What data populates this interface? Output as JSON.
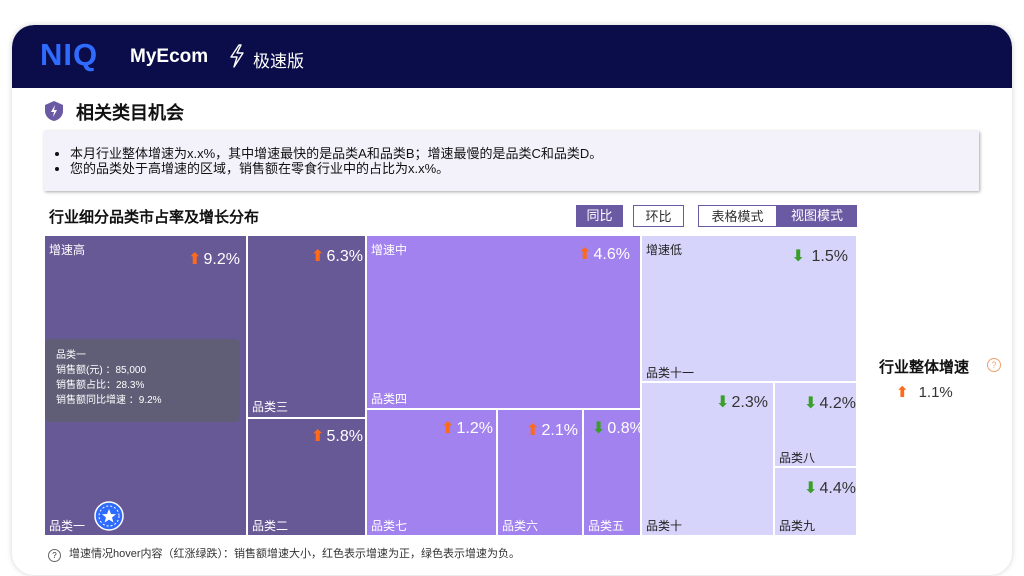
{
  "header": {
    "logo": "NIQ",
    "app_name": "MyEcom",
    "edition": "极速版"
  },
  "section": {
    "title": "相关类目机会"
  },
  "insights": [
    "本月行业整体增速为x.x%，其中增速最快的是品类A和品类B；增速最慢的是品类C和品类D。",
    "您的品类处于高增速的区域，销售额在零食行业中的占比为x.x%。"
  ],
  "chart": {
    "title": "行业细分品类市占率及增长分布"
  },
  "toggles": {
    "yoy": "同比",
    "mom": "环比",
    "table_mode": "表格模式",
    "view_mode": "视图模式"
  },
  "groups": {
    "high": "增速高",
    "mid": "增速中",
    "low": "增速低"
  },
  "tiles": {
    "cat1": {
      "name": "品类一",
      "growth": "9.2%"
    },
    "cat3": {
      "name": "品类三",
      "growth": "6.3%"
    },
    "cat2": {
      "name": "品类二",
      "growth": "5.8%"
    },
    "cat4": {
      "name": "品类四",
      "growth": "4.6%"
    },
    "cat7": {
      "name": "品类七",
      "growth": "1.2%"
    },
    "cat6": {
      "name": "品类六",
      "growth": "2.1%"
    },
    "cat5": {
      "name": "品类五",
      "growth": "0.8%"
    },
    "cat11": {
      "name": "品类十一",
      "growth": "1.5%"
    },
    "cat10": {
      "name": "品类十",
      "growth": "2.3%"
    },
    "cat8": {
      "name": "品类八",
      "growth": "4.2%"
    },
    "cat9": {
      "name": "品类九",
      "growth": "4.4%"
    }
  },
  "tooltip": {
    "name": "品类一",
    "sales": "销售额(元) ：85,000",
    "share": "销售额占比：28.3%",
    "yoy": "销售额同比增速 ：9.2%"
  },
  "overall": {
    "title": "行业整体增速",
    "value": "1.1%",
    "help": "?"
  },
  "footer": {
    "note": "增速情况hover内容（红涨绿跌）：销售额增速大小，红色表示增速为正，绿色表示增速为负。",
    "help": "?"
  },
  "colors": {
    "high": "#675896",
    "mid": "#a282ee",
    "low": "#d7d4fb",
    "up": "#ff6a1a",
    "down": "#3a9e2a",
    "header": "#0a0d4a"
  },
  "icons": {
    "bolt": "lightning-icon",
    "shield": "shield-badge-icon",
    "arrow_up": "arrow-up-icon",
    "arrow_down": "arrow-down-icon",
    "star": "star-badge-icon"
  }
}
